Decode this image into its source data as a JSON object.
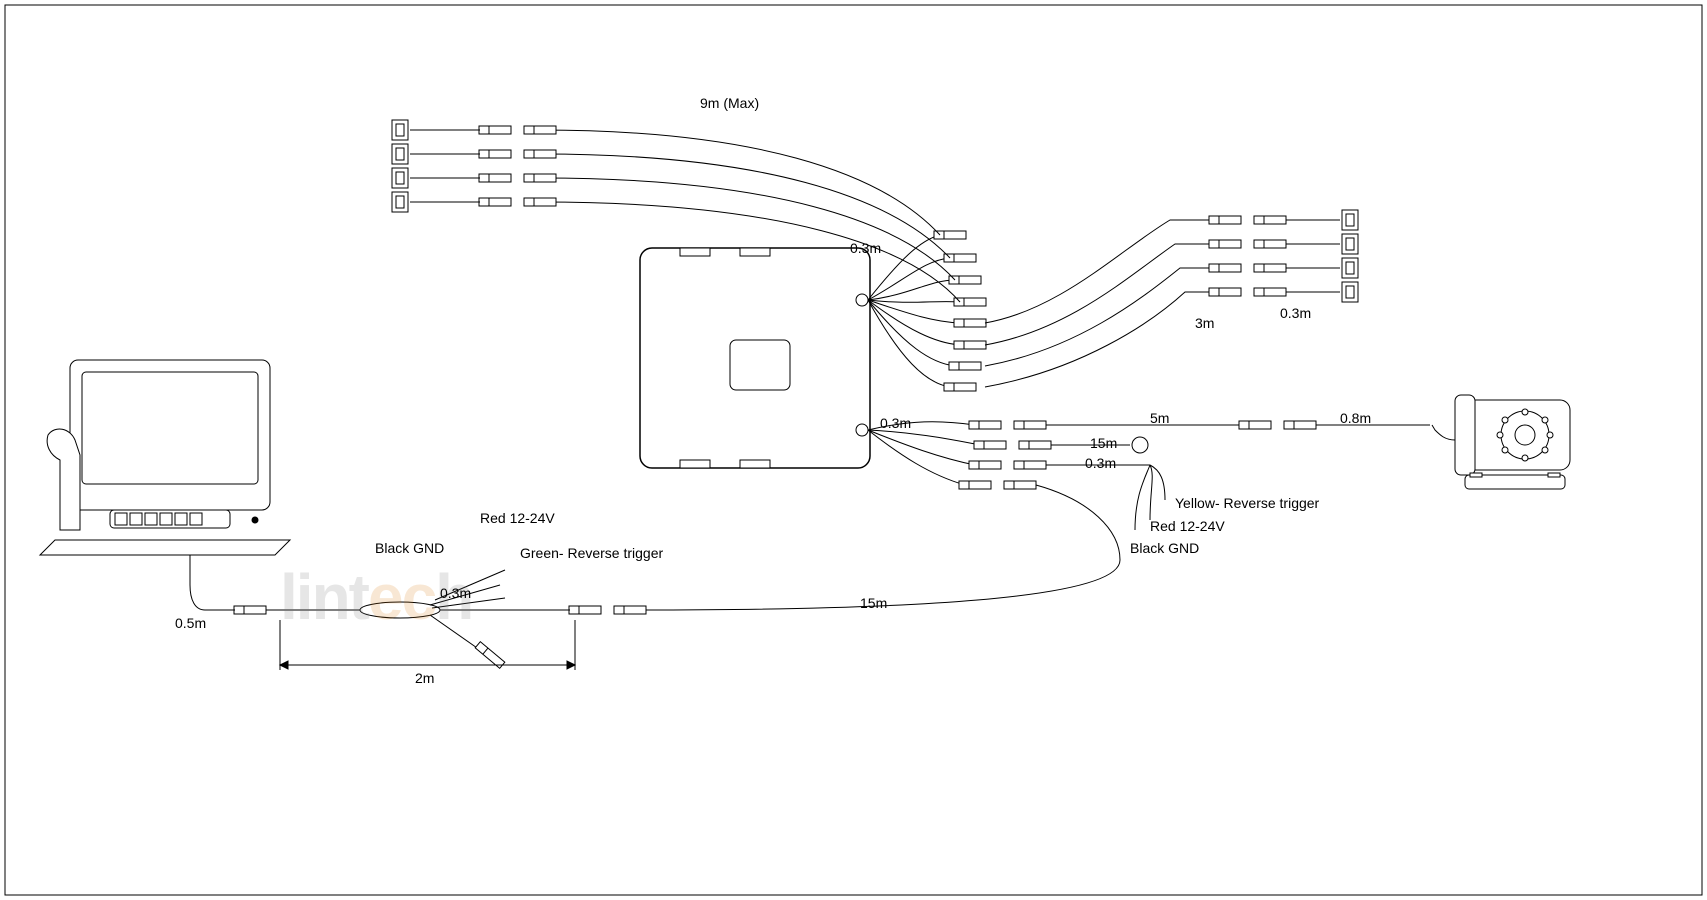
{
  "labels": {
    "top9m": "9m (Max)",
    "p03a": "0.3m",
    "p03b": "0.3m",
    "p3m": "3m",
    "p03c": "0.3m",
    "p5m": "5m",
    "p15m": "15m",
    "p03d": "0.3m",
    "p08m": "0.8m",
    "yellow": "Yellow- Reverse trigger",
    "red2": "Red 12-24V",
    "blk2": "Black GND",
    "red1": "Red 12-24V",
    "blk1": "Black GND",
    "green": "Green- Reverse trigger",
    "p03e": "0.3m",
    "p15m2": "15m",
    "p05m": "0.5m",
    "p2m": "2m"
  },
  "watermark": "lintech"
}
